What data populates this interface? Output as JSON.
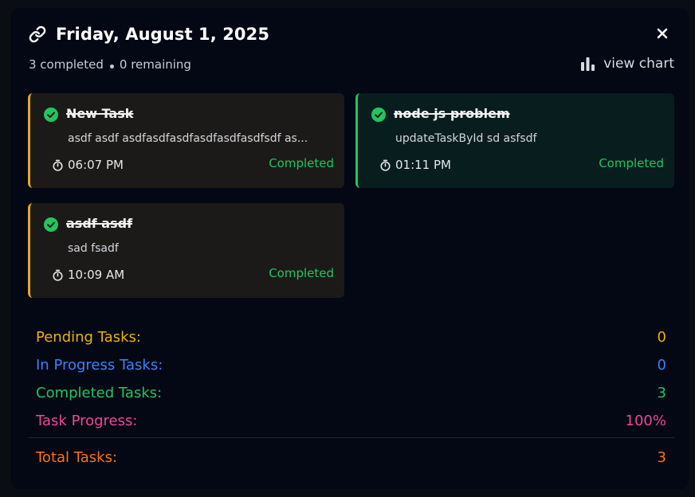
{
  "dialog": {
    "title": "Friday, August 1, 2025",
    "close_icon": "close-icon",
    "link_icon": "link-icon"
  },
  "summary": {
    "completed_text": "3 completed",
    "remaining_text": "0 remaining"
  },
  "view_chart": {
    "label": "view chart",
    "icon": "bar-chart-icon"
  },
  "tasks": [
    {
      "title": "New Task",
      "description": "asdf asdf asdfasdfasdfasdfasdfasdfsdf as...",
      "time": "06:07 PM",
      "status": "Completed",
      "accent": "#e5a823"
    },
    {
      "title": "node js problem",
      "description": "updateTaskById sd asfsdf",
      "time": "01:11 PM",
      "status": "Completed",
      "accent": "#22c55e"
    },
    {
      "title": "asdf asdf",
      "description": "sad fsadf",
      "time": "10:09 AM",
      "status": "Completed",
      "accent": "#e5a823"
    }
  ],
  "stats": [
    {
      "label": "Pending Tasks:",
      "value": "0",
      "color": "#eab308"
    },
    {
      "label": "In Progress Tasks:",
      "value": "0",
      "color": "#3b82f6"
    },
    {
      "label": "Completed Tasks:",
      "value": "3",
      "color": "#22c55e"
    },
    {
      "label": "Task Progress:",
      "value": "100%",
      "color": "#ec4899"
    }
  ],
  "total": {
    "label": "Total Tasks:",
    "value": "3",
    "color": "#f97316"
  }
}
